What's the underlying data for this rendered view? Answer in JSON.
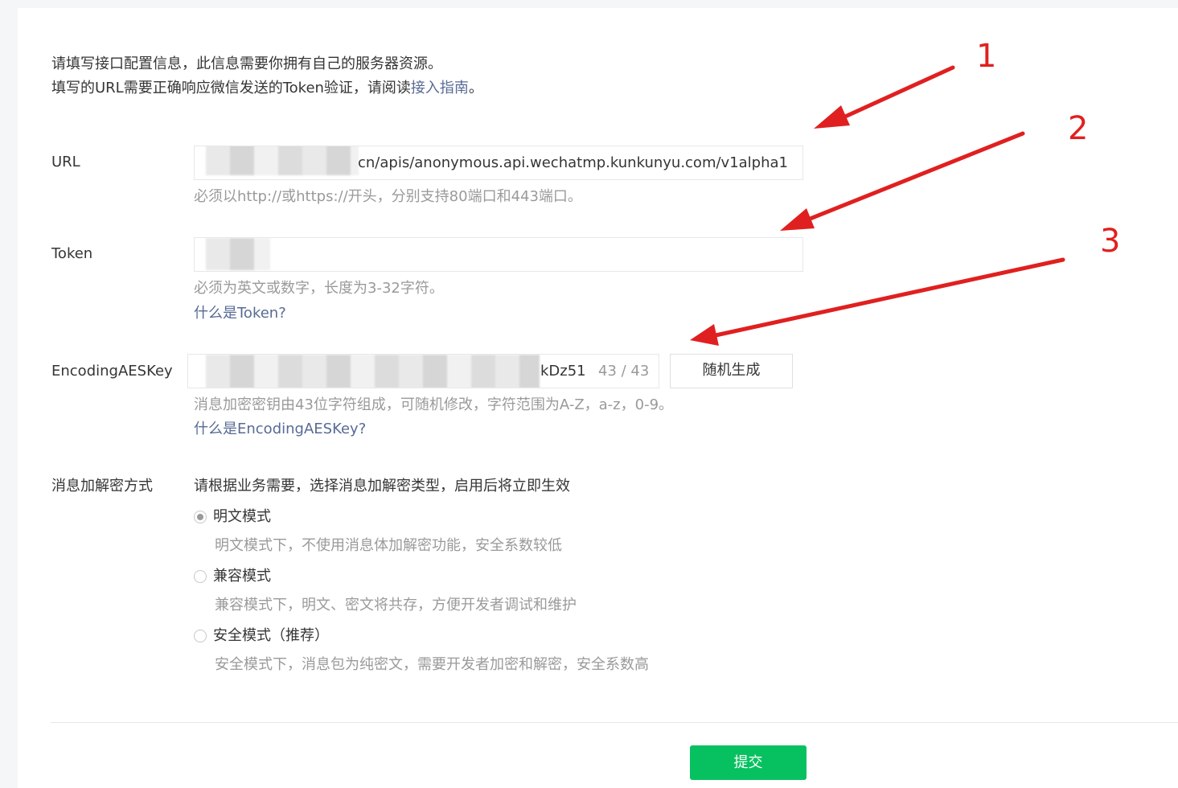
{
  "intro": {
    "line1": "请填写接口配置信息，此信息需要你拥有自己的服务器资源。",
    "line2_prefix": "填写的URL需要正确响应微信发送的Token验证，请阅读",
    "line2_link": "接入指南",
    "line2_suffix": "。"
  },
  "fields": {
    "url": {
      "label": "URL",
      "value_visible": "cn/apis/anonymous.api.wechatmp.kunkunyu.com/v1alpha1",
      "hint": "必须以http://或https://开头，分别支持80端口和443端口。"
    },
    "token": {
      "label": "Token",
      "hint": "必须为英文或数字，长度为3-32字符。",
      "help_link": "什么是Token?"
    },
    "aes": {
      "label": "EncodingAESKey",
      "value_visible": "kDz51",
      "counter_current": "43",
      "counter_sep": " / ",
      "counter_max": "43",
      "random_button": "随机生成",
      "hint": "消息加密密钥由43位字符组成，可随机修改，字符范围为A-Z，a-z，0-9。",
      "help_link": "什么是EncodingAESKey?"
    },
    "encryption": {
      "label": "消息加解密方式",
      "description": "请根据业务需要，选择消息加解密类型，启用后将立即生效",
      "options": [
        {
          "label": "明文模式",
          "desc": "明文模式下，不使用消息体加解密功能，安全系数较低",
          "checked": true
        },
        {
          "label": "兼容模式",
          "desc": "兼容模式下，明文、密文将共存，方便开发者调试和维护",
          "checked": false
        },
        {
          "label": "安全模式（推荐）",
          "desc": "安全模式下，消息包为纯密文，需要开发者加密和解密，安全系数高",
          "checked": false
        }
      ]
    }
  },
  "submit_label": "提交",
  "annotations": {
    "color": "#e02020",
    "labels": [
      "1",
      "2",
      "3"
    ]
  }
}
